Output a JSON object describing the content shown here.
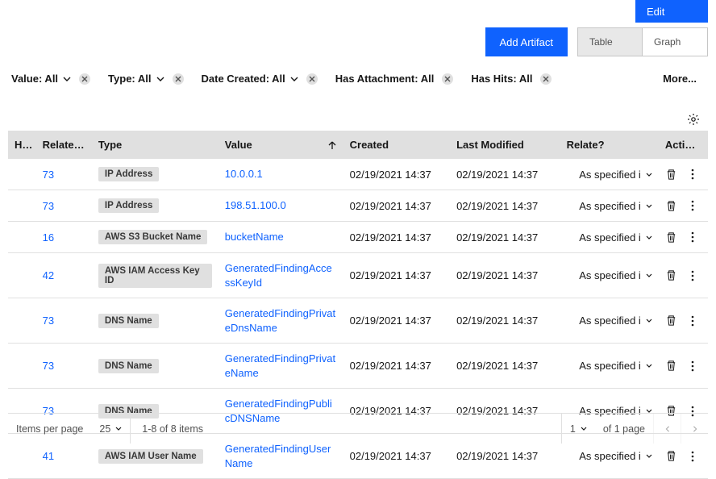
{
  "header": {
    "edit_label": "Edit",
    "add_artifact_label": "Add Artifact",
    "view_tabs": {
      "table": "Table",
      "graph": "Graph"
    }
  },
  "filters": {
    "value": "Value: All",
    "type": "Type: All",
    "date_created": "Date Created: All",
    "has_attachment": "Has Attachment: All",
    "has_hits": "Has Hits: All",
    "more": "More..."
  },
  "columns": {
    "hits": "Hits",
    "related": "Related I...",
    "type": "Type",
    "value": "Value",
    "created": "Created",
    "modified": "Last Modified",
    "relate": "Relate?",
    "actions": "Actions"
  },
  "rows": [
    {
      "related": "73",
      "type": "IP Address",
      "value": "10.0.0.1",
      "created": "02/19/2021 14:37",
      "modified": "02/19/2021 14:37",
      "relate": "As specified i"
    },
    {
      "related": "73",
      "type": "IP Address",
      "value": "198.51.100.0",
      "created": "02/19/2021 14:37",
      "modified": "02/19/2021 14:37",
      "relate": "As specified i"
    },
    {
      "related": "16",
      "type": "AWS S3 Bucket Name",
      "value": "bucketName",
      "created": "02/19/2021 14:37",
      "modified": "02/19/2021 14:37",
      "relate": "As specified i"
    },
    {
      "related": "42",
      "type": "AWS IAM Access Key ID",
      "value": "GeneratedFindingAccessKeyId",
      "created": "02/19/2021 14:37",
      "modified": "02/19/2021 14:37",
      "relate": "As specified i"
    },
    {
      "related": "73",
      "type": "DNS Name",
      "value": "GeneratedFindingPrivateDnsName",
      "created": "02/19/2021 14:37",
      "modified": "02/19/2021 14:37",
      "relate": "As specified i"
    },
    {
      "related": "73",
      "type": "DNS Name",
      "value": "GeneratedFindingPrivateName",
      "created": "02/19/2021 14:37",
      "modified": "02/19/2021 14:37",
      "relate": "As specified i"
    },
    {
      "related": "73",
      "type": "DNS Name",
      "value": "GeneratedFindingPublicDNSName",
      "created": "02/19/2021 14:37",
      "modified": "02/19/2021 14:37",
      "relate": "As specified i"
    },
    {
      "related": "41",
      "type": "AWS IAM User Name",
      "value": "GeneratedFindingUserName",
      "created": "02/19/2021 14:37",
      "modified": "02/19/2021 14:37",
      "relate": "As specified i"
    }
  ],
  "pagination": {
    "items_per_page_label": "Items per page",
    "items_per_page_value": "25",
    "range_text": "1-8 of 8 items",
    "current_page": "1",
    "of_pages": "of 1 page"
  }
}
